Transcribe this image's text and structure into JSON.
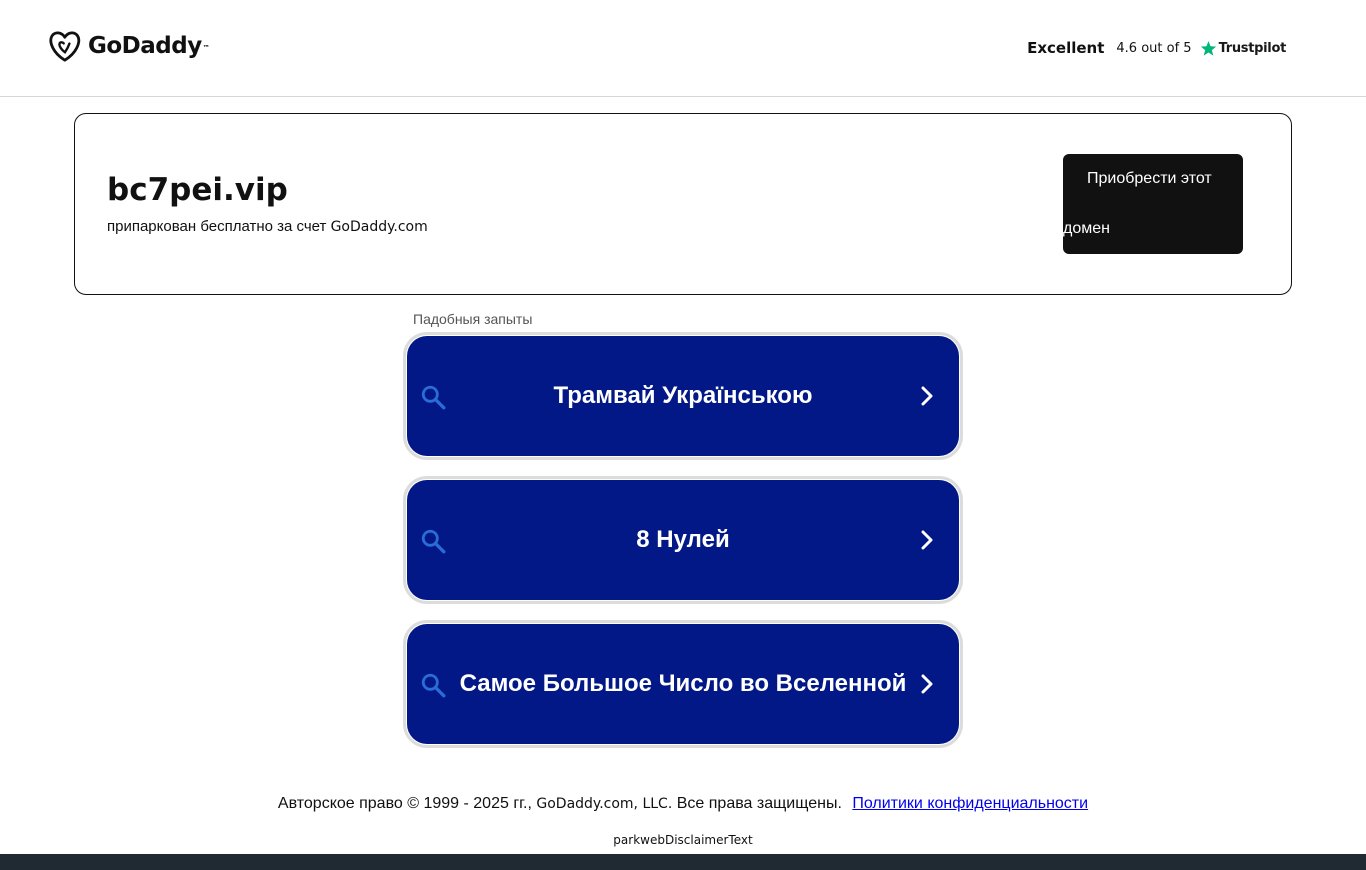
{
  "header": {
    "logo_text": "GoDaddy",
    "logo_tm": "™",
    "rating_label": "Excellent",
    "rating_score": "4.6 out of 5",
    "trustpilot_word": "Trustpilot",
    "trustpilot_star_color": "#00b67a"
  },
  "domain": {
    "name": "bc7pei.vip",
    "parked_prefix": "припаркован бесплатно за счет ",
    "parked_brand": "GoDaddy.com",
    "buy_line1": "Приобрести этот",
    "buy_line2": "домен"
  },
  "related": {
    "label": "Падобныя запыты",
    "items": [
      {
        "text": "Трамвай Українською"
      },
      {
        "text": "8 Нулей"
      },
      {
        "text": "Самое Большое Число во Вселенной"
      }
    ],
    "button_color": "#021887",
    "icon_color": "#2a6dd6"
  },
  "footer": {
    "copyright_prefix": "Авторское право © 1999 - 2025 гг., ",
    "copyright_brand": "GoDaddy.com, LLC.",
    "copyright_suffix": " Все права защищены.",
    "privacy_link": "Политики конфиденциальности",
    "disclaimer": "parkwebDisclaimerText"
  }
}
